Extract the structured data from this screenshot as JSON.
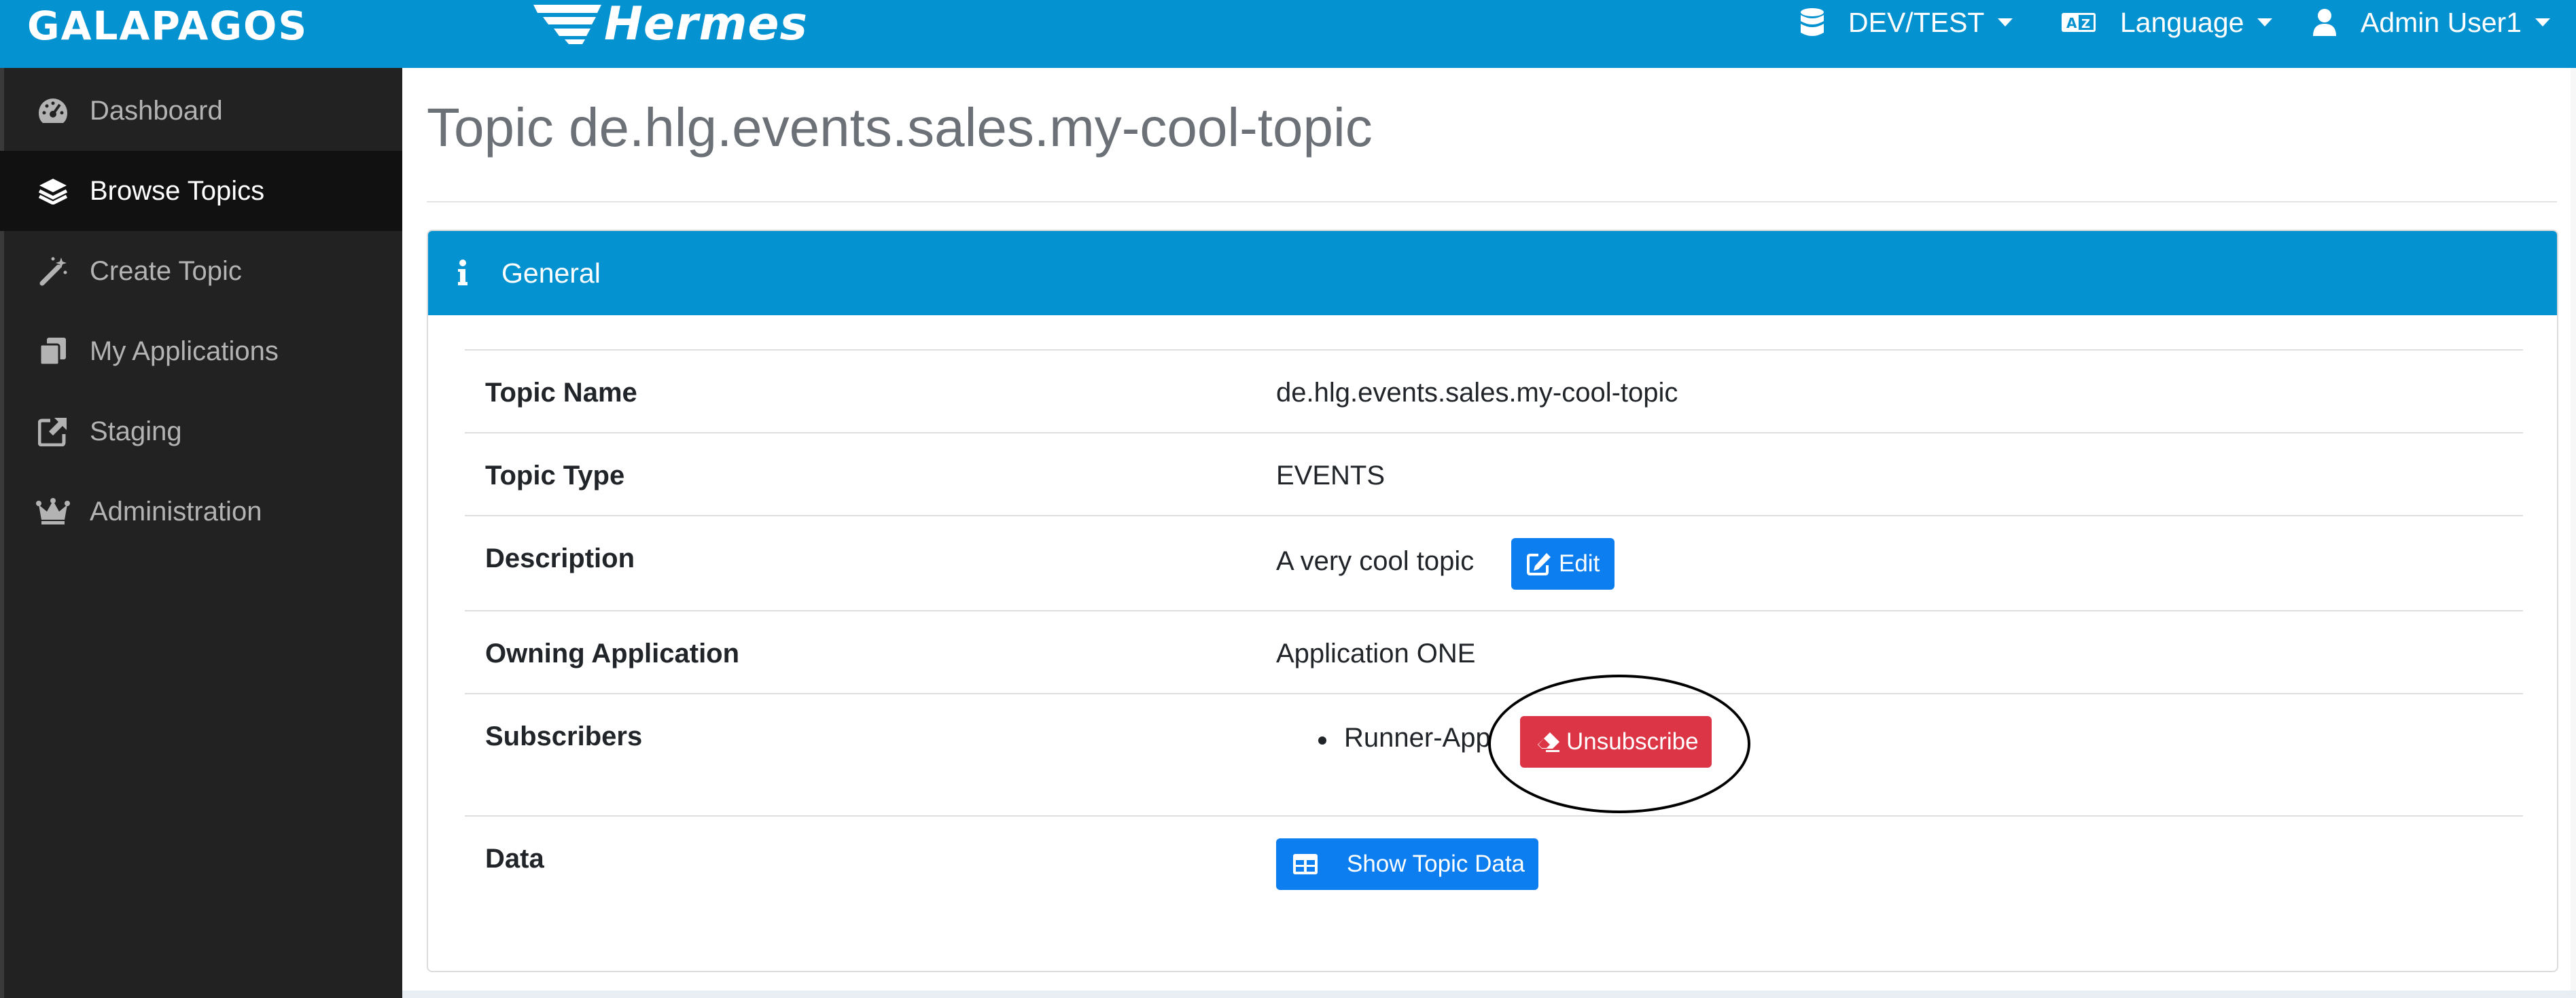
{
  "navbar": {
    "brand": "GALAPAGOS",
    "logo_text": "Hermes",
    "environment": "DEV/TEST",
    "language": "Language",
    "user": "Admin User1"
  },
  "sidebar": {
    "items": [
      {
        "label": "Dashboard",
        "icon": "gauge-icon"
      },
      {
        "label": "Browse Topics",
        "icon": "layers-icon",
        "active": true
      },
      {
        "label": "Create Topic",
        "icon": "magic-wand-icon"
      },
      {
        "label": "My Applications",
        "icon": "copy-icon"
      },
      {
        "label": "Staging",
        "icon": "external-link-icon"
      },
      {
        "label": "Administration",
        "icon": "crown-icon"
      }
    ]
  },
  "page": {
    "title": "Topic de.hlg.events.sales.my-cool-topic"
  },
  "card": {
    "header": "General",
    "rows": [
      {
        "label": "Topic Name",
        "value": "de.hlg.events.sales.my-cool-topic"
      },
      {
        "label": "Topic Type",
        "value": "EVENTS"
      },
      {
        "label": "Description",
        "value": "A very cool topic",
        "action": "Edit"
      },
      {
        "label": "Owning Application",
        "value": "Application ONE"
      },
      {
        "label": "Subscribers",
        "subscribers": [
          "Runner-App"
        ],
        "action": "Unsubscribe"
      },
      {
        "label": "Data",
        "action": "Show Topic Data"
      }
    ]
  },
  "colors": {
    "navbar": "#0592d1",
    "sidebar": "#222222",
    "primary": "#0d7ef0",
    "danger": "#dc3545"
  }
}
